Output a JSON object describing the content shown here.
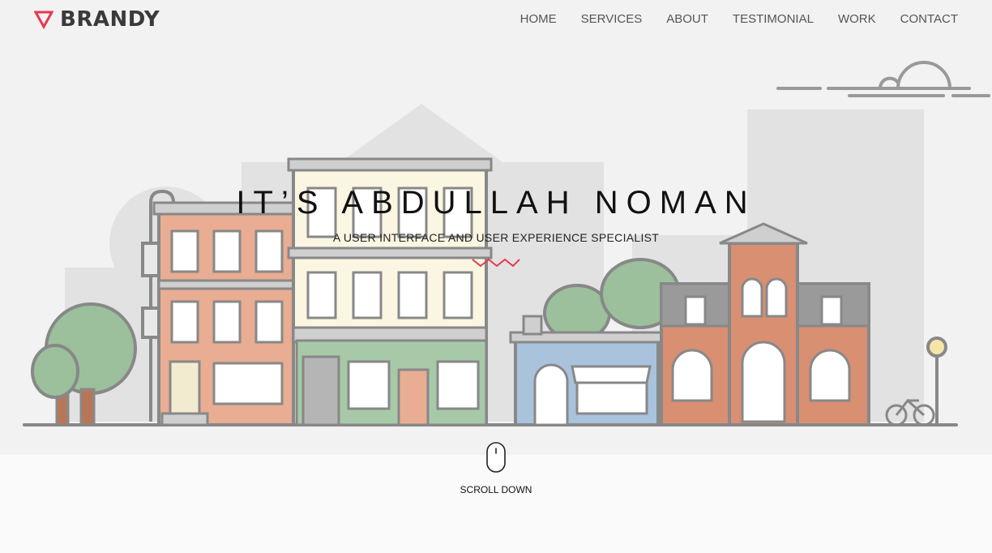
{
  "brand": {
    "name": "BRANDY",
    "accent": "#e8384f"
  },
  "nav": {
    "items": [
      {
        "label": "HOME"
      },
      {
        "label": "SERVICES"
      },
      {
        "label": "ABOUT"
      },
      {
        "label": "TESTIMONIAL"
      },
      {
        "label": "WORK"
      },
      {
        "label": "CONTACT"
      }
    ]
  },
  "hero": {
    "title": "IT’S ABDULLAH NOMAN",
    "subtitle": "A USER INTERFACE AND USER EXPERIENCE SPECIALIST",
    "divider_icon": "zigzag-icon"
  },
  "scroll": {
    "label": "SCROLL DOWN",
    "icon": "mouse-icon"
  },
  "colors": {
    "background": "#f2f2f2",
    "text": "#111111",
    "nav_text": "#555555"
  }
}
